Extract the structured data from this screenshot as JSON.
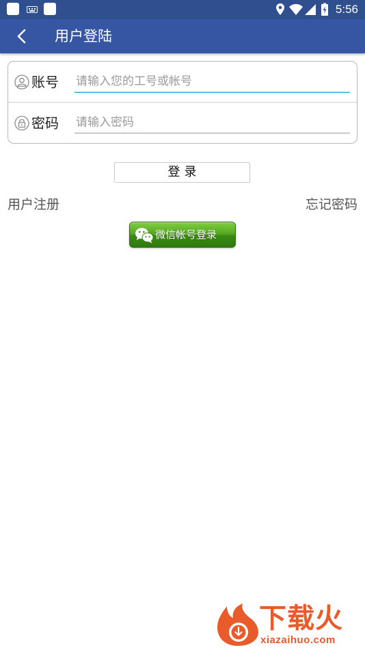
{
  "status_bar": {
    "time": "5:56",
    "icons": [
      "app-square-icon",
      "keyboard-icon",
      "app-square-icon",
      "location-icon",
      "wifi-icon",
      "signal-icon",
      "battery-charging-icon"
    ]
  },
  "app_bar": {
    "back_icon": "chevron-left-icon",
    "title": "用户登陆"
  },
  "login_form": {
    "account": {
      "label": "账号",
      "placeholder": "请输入您的工号或帐号",
      "value": "",
      "icon": "user-icon"
    },
    "password": {
      "label": "密码",
      "placeholder": "请输入密码",
      "value": "",
      "icon": "lock-icon"
    }
  },
  "login_button": {
    "label": "登录"
  },
  "links": {
    "register": "用户注册",
    "forgot_password": "忘记密码"
  },
  "wechat_login": {
    "label": "微信帐号登录",
    "icon": "wechat-icon"
  },
  "watermark": {
    "title": "下载火",
    "domain": "xiazaihuo.com"
  },
  "colors": {
    "status_bar": "#2f4f8f",
    "app_bar": "#3656a3",
    "focused_underline": "#5bc0e8",
    "wechat_green": "#56a824",
    "watermark_orange": "#e95b2a"
  }
}
